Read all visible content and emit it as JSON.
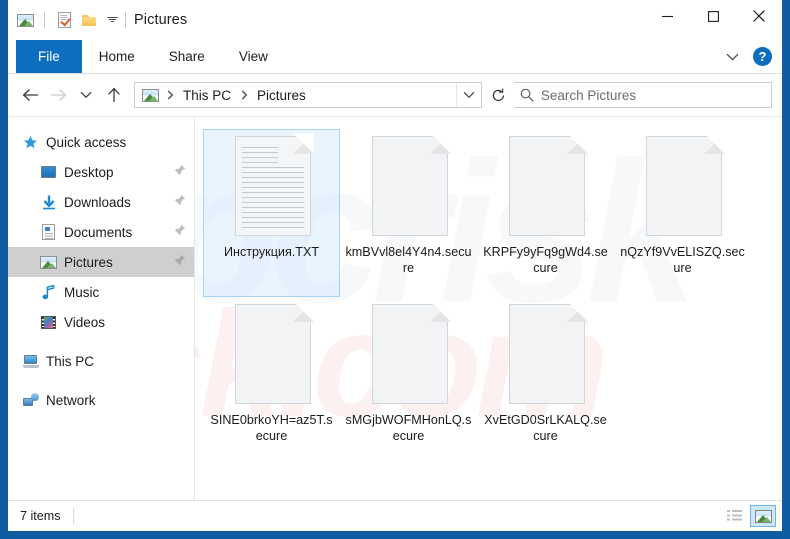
{
  "window": {
    "title": "Pictures",
    "quick_access_toolbar": [
      {
        "name": "pictures-folder-icon",
        "label": "Pictures"
      },
      {
        "name": "properties-icon",
        "label": "Properties"
      },
      {
        "name": "new-folder-icon",
        "label": "New folder"
      },
      {
        "name": "customize-qat-caret-icon",
        "label": "Customize Quick Access Toolbar"
      }
    ],
    "controls": {
      "minimize": "Minimize",
      "maximize": "Maximize",
      "close": "Close"
    }
  },
  "ribbon": {
    "tabs": [
      {
        "label": "File",
        "active": true
      },
      {
        "label": "Home",
        "active": false
      },
      {
        "label": "Share",
        "active": false
      },
      {
        "label": "View",
        "active": false
      }
    ],
    "expand_label": "Expand the Ribbon",
    "help_label": "?"
  },
  "navigation": {
    "back": "Back",
    "forward": "Forward",
    "recent": "Recent locations",
    "up": "Up",
    "refresh": "Refresh",
    "breadcrumb": [
      "This PC",
      "Pictures"
    ],
    "breadcrumb_separator": "›"
  },
  "search": {
    "placeholder": "Search Pictures",
    "value": ""
  },
  "sidebar": {
    "items": [
      {
        "label": "Quick access",
        "icon": "star-icon",
        "indent": false,
        "pinned": false,
        "selected": false
      },
      {
        "label": "Desktop",
        "icon": "desktop-icon",
        "indent": true,
        "pinned": true,
        "selected": false
      },
      {
        "label": "Downloads",
        "icon": "downloads-icon",
        "indent": true,
        "pinned": true,
        "selected": false
      },
      {
        "label": "Documents",
        "icon": "documents-icon",
        "indent": true,
        "pinned": true,
        "selected": false
      },
      {
        "label": "Pictures",
        "icon": "pictures-icon",
        "indent": true,
        "pinned": true,
        "selected": true
      },
      {
        "label": "Music",
        "icon": "music-icon",
        "indent": true,
        "pinned": false,
        "selected": false
      },
      {
        "label": "Videos",
        "icon": "videos-icon",
        "indent": true,
        "pinned": false,
        "selected": false
      },
      {
        "label": "This PC",
        "icon": "this-pc-icon",
        "indent": false,
        "pinned": false,
        "selected": false
      },
      {
        "label": "Network",
        "icon": "network-icon",
        "indent": false,
        "pinned": false,
        "selected": false
      }
    ]
  },
  "files": [
    {
      "name": "Инструкция.TXT",
      "type": "text",
      "selected": true
    },
    {
      "name": "kmBVvl8el4Y4n4.secure",
      "type": "blank",
      "selected": false
    },
    {
      "name": "KRPFy9yFq9gWd4.secure",
      "type": "blank",
      "selected": false
    },
    {
      "name": "nQzYf9VvELISZQ.secure",
      "type": "blank",
      "selected": false
    },
    {
      "name": "SINE0brkoYH=az5T.secure",
      "type": "blank",
      "selected": false
    },
    {
      "name": "sMGjbWOFMHonLQ.secure",
      "type": "blank",
      "selected": false
    },
    {
      "name": "XvEtGD0SrLKALQ.secure",
      "type": "blank",
      "selected": false
    }
  ],
  "statusbar": {
    "item_count": "7 items",
    "views": [
      {
        "name": "details-view-button",
        "label": "Details view",
        "active": false
      },
      {
        "name": "large-icons-view-button",
        "label": "Large icons view",
        "active": true
      }
    ]
  },
  "watermark": {
    "back": "pcrisk",
    "front": "risk.com"
  }
}
